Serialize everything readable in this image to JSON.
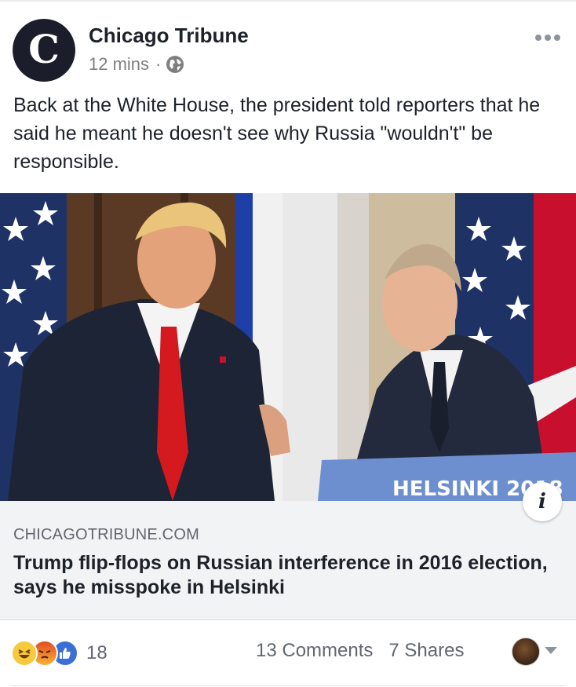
{
  "post": {
    "page_name": "Chicago Tribune",
    "avatar_letter": "C",
    "timestamp": "12 mins",
    "separator": "·",
    "privacy_icon": "globe-icon",
    "more_icon": "more-options-icon",
    "text": "Back at the White House, the president told reporters that he said he meant he doesn't see why Russia \"wouldn't\" be responsible."
  },
  "photo": {
    "podium_text": "HELSINKI 2018",
    "info_icon_glyph": "i"
  },
  "link": {
    "domain": "CHICAGOTRIBUNE.COM",
    "title": "Trump flip-flops on Russian interference in 2016 election, says he misspoke in Helsinki"
  },
  "footer": {
    "reaction_icons": [
      "haha-icon",
      "angry-icon",
      "like-icon"
    ],
    "reaction_count": "18",
    "comments": "13 Comments",
    "shares": "7 Shares"
  },
  "colors": {
    "text_primary": "#1d2129",
    "text_secondary": "#606770",
    "link_bg": "#f2f3f5",
    "like_blue": "#3b6fd6",
    "flag_blue": "#1f3fa8",
    "flag_red": "#c8102e",
    "podium_blue": "#6d8fcf"
  }
}
